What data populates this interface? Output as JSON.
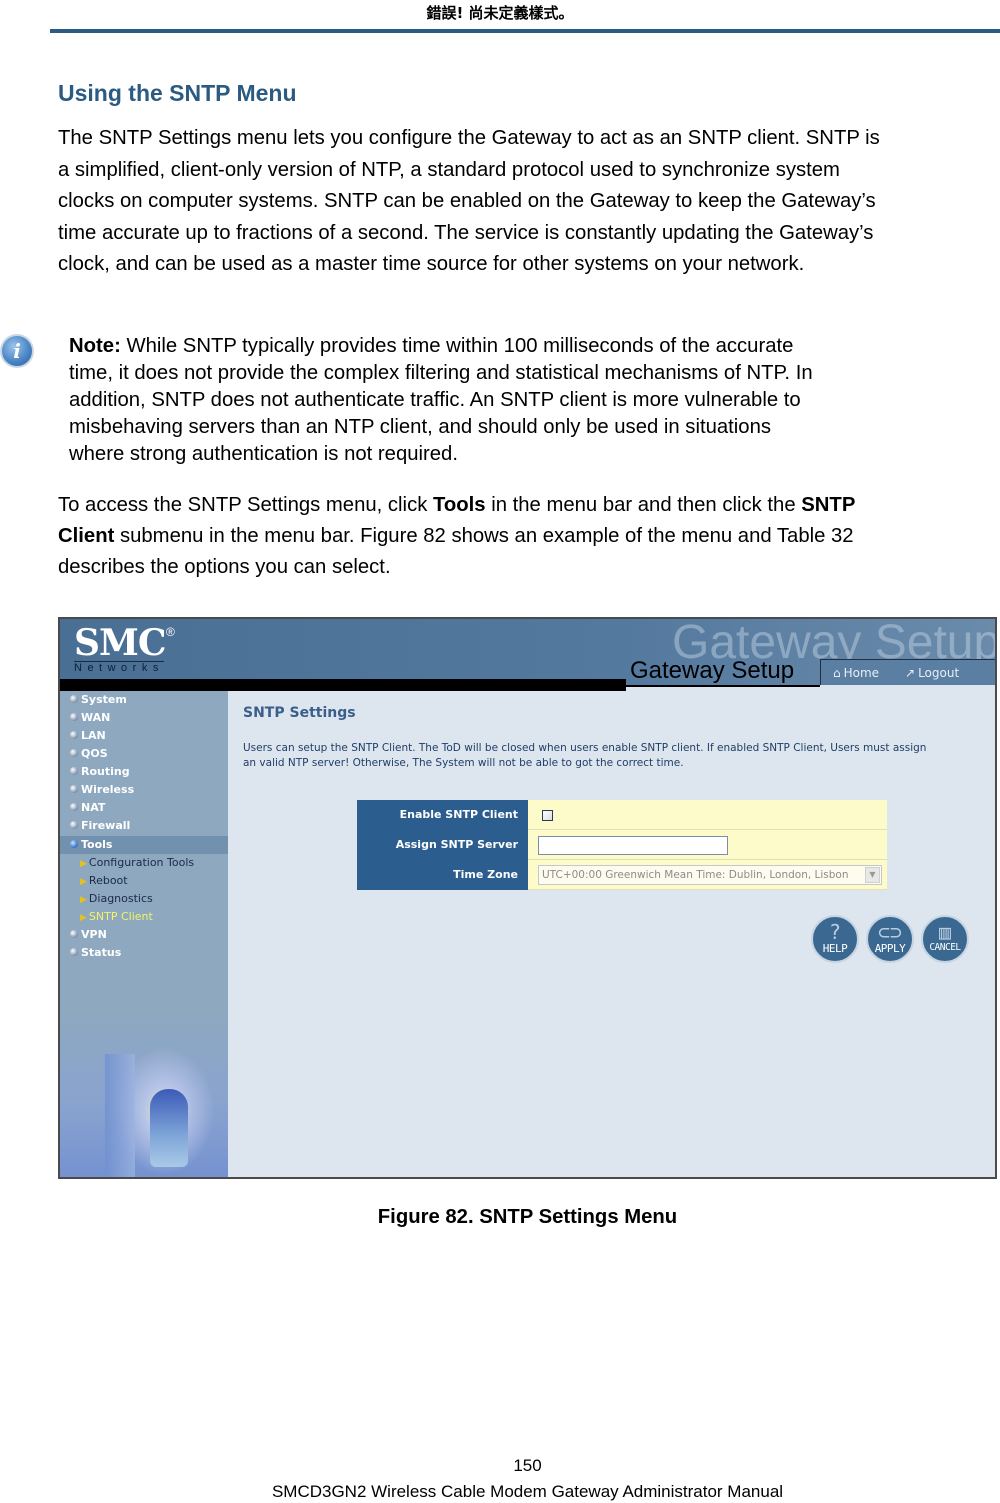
{
  "running_header": "錯誤! 尚未定義樣式。",
  "section_title": "Using the SNTP Menu",
  "intro_lines": [
    "The SNTP Settings menu lets you configure the Gateway to act as an SNTP client. SNTP is",
    "a simplified, client-only version of NTP, a standard protocol used to synchronize system",
    "clocks on computer systems. SNTP can be enabled on the Gateway to keep the Gateway’s",
    "time accurate up to fractions of a second. The service is constantly updating the Gateway’s",
    "clock, and can be used as a master time source for other systems on your network."
  ],
  "note": {
    "icon": "info-icon",
    "label": "Note:",
    "first_line_rest": " While SNTP typically provides time within 100 milliseconds of the accurate",
    "lines": [
      "time, it does not provide the complex filtering and statistical mechanisms of NTP. In",
      "addition, SNTP does not authenticate traffic. An SNTP client is more vulnerable to",
      "misbehaving servers than an NTP client, and should only be used in situations",
      "where strong authentication is not required."
    ]
  },
  "access": {
    "line1_pre": "To access the SNTP Settings menu, click ",
    "line1_bold1": "Tools",
    "line1_mid": " in the menu bar and then click the ",
    "line1_bold2": "SNTP",
    "line2_bold": "Client",
    "line2_rest": " submenu in the menu bar. Figure 82 shows an example of the menu and Table 32",
    "line3": "describes the options you can select."
  },
  "figure": {
    "logo": "SMC",
    "logo_reg": "®",
    "logo_sub": "Networks",
    "watermark": "Gateway Setup",
    "banner_title": "Gateway Setup",
    "nav": [
      {
        "label": "Home",
        "icon": "home-icon"
      },
      {
        "label": "Logout",
        "icon": "logout-icon"
      }
    ],
    "menu": [
      {
        "label": "System"
      },
      {
        "label": "WAN"
      },
      {
        "label": "LAN"
      },
      {
        "label": "QOS"
      },
      {
        "label": "Routing"
      },
      {
        "label": "Wireless"
      },
      {
        "label": "NAT"
      },
      {
        "label": "Firewall"
      },
      {
        "label": "Tools",
        "active": true
      }
    ],
    "submenu": [
      {
        "label": "Configuration Tools"
      },
      {
        "label": "Reboot"
      },
      {
        "label": "Diagnostics"
      },
      {
        "label": "SNTP Client",
        "current": true
      }
    ],
    "menu_after": [
      {
        "label": "VPN"
      },
      {
        "label": "Status"
      }
    ],
    "content_title": "SNTP Settings",
    "content_desc_lines": [
      "Users can setup the SNTP Client. The ToD will be closed when users enable SNTP client. If enabled SNTP Client, Users must assign",
      "an valid NTP server! Otherwise, The System will not be able to got the correct time."
    ],
    "fields": {
      "enable_label": "Enable SNTP Client",
      "enable_checked": false,
      "server_label": "Assign SNTP Server",
      "server_value": "",
      "timezone_label": "Time Zone",
      "timezone_value": "UTC+00:00 Greenwich Mean Time: Dublin, London, Lisbon"
    },
    "buttons": [
      {
        "label": "HELP",
        "icon": "help-icon"
      },
      {
        "label": "APPLY",
        "icon": "apply-icon"
      },
      {
        "label": "CANCEL",
        "icon": "cancel-icon"
      }
    ]
  },
  "caption": "Figure 82. SNTP Settings Menu",
  "page_number": "150",
  "footer": "SMCD3GN2 Wireless Cable Modem Gateway Administrator Manual"
}
